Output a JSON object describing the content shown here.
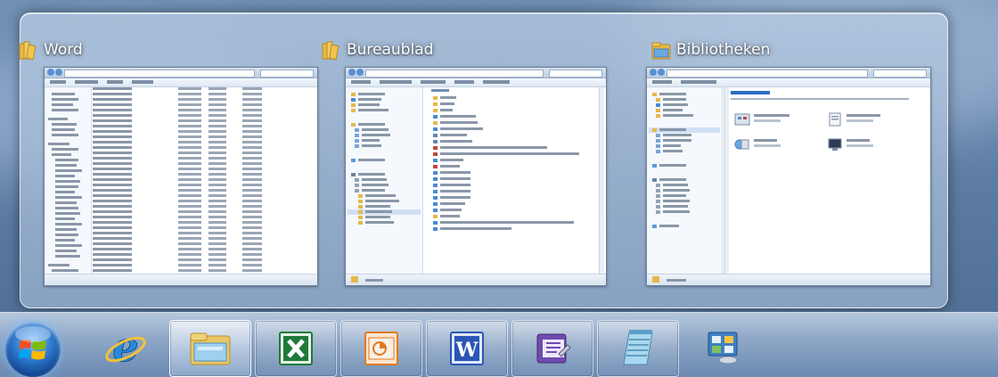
{
  "peek": {
    "thumbnails": [
      {
        "title": "Word"
      },
      {
        "title": "Bureaublad"
      },
      {
        "title": "Bibliotheken"
      }
    ]
  },
  "taskbar": {
    "items": [
      {
        "icon": "windows-start-orb-icon"
      },
      {
        "icon": "internet-explorer-icon"
      },
      {
        "icon": "windows-explorer-icon"
      },
      {
        "icon": "excel-icon"
      },
      {
        "icon": "powerpoint-icon"
      },
      {
        "icon": "word-icon"
      },
      {
        "icon": "infopath-icon"
      },
      {
        "icon": "notepad-icon"
      },
      {
        "icon": "control-panel-icon"
      }
    ]
  },
  "colors": {
    "folder_yellow": "#e8b94a",
    "explorer_blue": "#2b74c9",
    "excel_green": "#1f7a3a",
    "powerpoint_orange": "#e07a1f",
    "word_blue": "#2a56b5"
  }
}
